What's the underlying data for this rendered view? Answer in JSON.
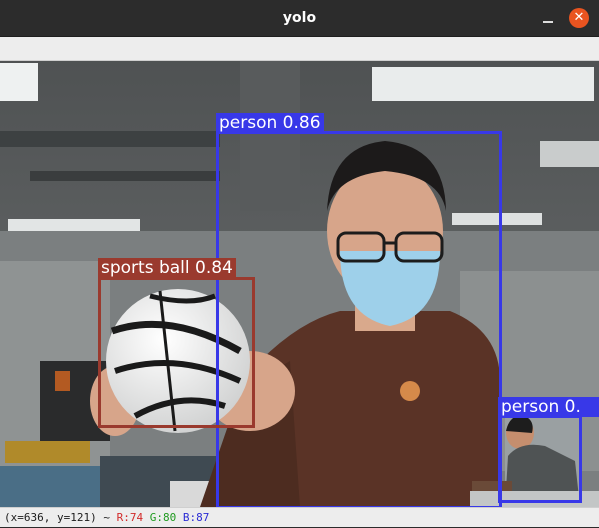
{
  "window": {
    "title": "yolo"
  },
  "titlebar": {
    "minimize_symbol": "–",
    "close_symbol": "✕"
  },
  "detections": [
    {
      "label": "person 0.86",
      "color": "#3838e8"
    },
    {
      "label": "sports ball 0.84",
      "color": "#9a3a2e"
    },
    {
      "label": "person 0.",
      "color": "#3838e8"
    }
  ],
  "status": {
    "coords": "(x=636, y=121) ~",
    "r": "R:74",
    "g": "G:80",
    "b": "B:87"
  },
  "colors": {
    "titlebar": "#2c2c2c",
    "close_button": "#e95420",
    "person_box": "#3838e8",
    "ball_box": "#9a3a2e"
  }
}
